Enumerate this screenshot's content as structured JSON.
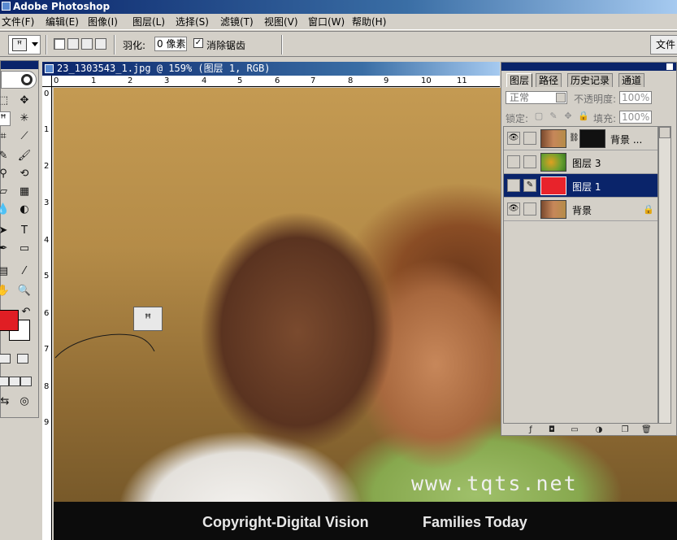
{
  "app": {
    "title": "Adobe Photoshop"
  },
  "menu": [
    {
      "label": "文件(F)"
    },
    {
      "label": "编辑(E)"
    },
    {
      "label": "图像(I)"
    },
    {
      "label": "图层(L)"
    },
    {
      "label": "选择(S)"
    },
    {
      "label": "滤镜(T)"
    },
    {
      "label": "视图(V)"
    },
    {
      "label": "窗口(W)"
    },
    {
      "label": "帮助(H)"
    }
  ],
  "options": {
    "feather_label": "羽化:",
    "feather_value": "0 像素",
    "antialias_checked": true,
    "antialias_label": "消除锯齿",
    "file_browser": "文件"
  },
  "document": {
    "title": "23_1303543_1.jpg @ 159% (图层 1, RGB)",
    "ruler_top": [
      "0",
      "1",
      "2",
      "3",
      "4",
      "5",
      "6",
      "7",
      "8",
      "9",
      "10",
      "11"
    ],
    "ruler_left": [
      "0",
      "1",
      "2",
      "3",
      "4",
      "5",
      "6",
      "7",
      "8",
      "9"
    ],
    "watermark": "www.tqts.net",
    "copyright": "Copyright-Digital Vision",
    "collection": "Families Today"
  },
  "colors": {
    "foreground": "#e01e24",
    "background": "#ffffff",
    "selection": "#0a246a",
    "layer1_fill": "#e8232b"
  },
  "layers_palette": {
    "tabs": [
      "图层",
      "路径",
      "历史记录",
      "通道"
    ],
    "blend_mode": "正常",
    "opacity_label": "不透明度:",
    "opacity_value": "100%",
    "lock_label": "锁定:",
    "fill_label": "填充:",
    "fill_value": "100%",
    "layers": [
      {
        "name": "背景 ...",
        "visible": true,
        "has_mask": true,
        "selected": false
      },
      {
        "name": "图层 3",
        "visible": false,
        "selected": false
      },
      {
        "name": "图层 1",
        "visible": false,
        "selected": true,
        "brush_link": true
      },
      {
        "name": "背景",
        "visible": true,
        "locked": true,
        "selected": false
      }
    ]
  },
  "icons": {
    "eye": "eye-icon",
    "brush": "brush-icon",
    "lock": "lock-icon",
    "lasso": "lasso-icon"
  }
}
